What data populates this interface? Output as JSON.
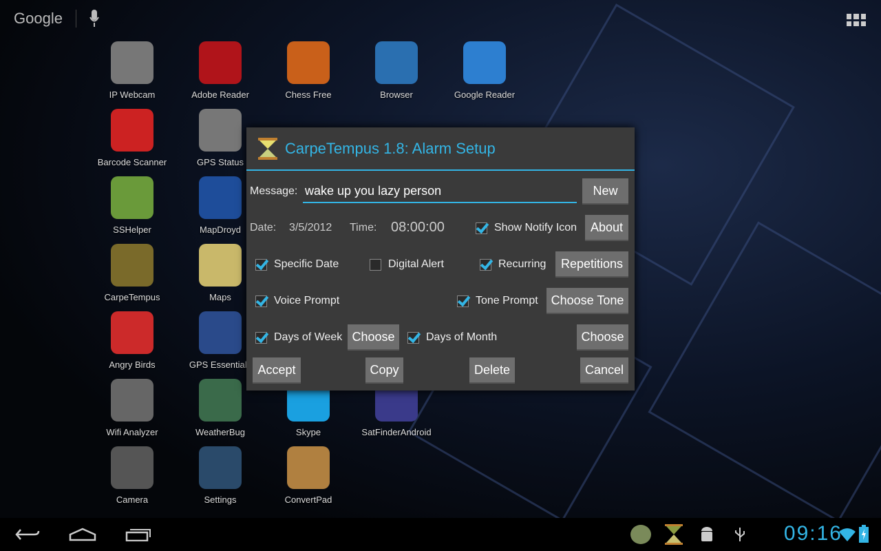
{
  "topbar": {
    "search_label": "Google"
  },
  "apps": [
    {
      "label": "IP Webcam",
      "color": "#777"
    },
    {
      "label": "Adobe Reader",
      "color": "#b0141a"
    },
    {
      "label": "Chess Free",
      "color": "#c9601a"
    },
    {
      "label": "Browser",
      "color": "#2a6fb0"
    },
    {
      "label": "Google Reader",
      "color": "#2d7fd0"
    },
    {
      "label": "Barcode Scanner",
      "color": "#cc2222"
    },
    {
      "label": "GPS Status",
      "color": "#777"
    },
    {
      "label": "SSHelper",
      "color": "#6a9a3a"
    },
    {
      "label": "MapDroyd",
      "color": "#1e4d9a"
    },
    {
      "label": "CarpeTempus",
      "color": "#7a6a2a"
    },
    {
      "label": "Maps",
      "color": "#c9b86a"
    },
    {
      "label": "Angry Birds",
      "color": "#cc2a2a"
    },
    {
      "label": "GPS Essentials",
      "color": "#2a4a8a"
    },
    {
      "label": "Wifi Analyzer",
      "color": "#666"
    },
    {
      "label": "WeatherBug",
      "color": "#3a6a4a"
    },
    {
      "label": "Skype",
      "color": "#1aa0e0"
    },
    {
      "label": "SatFinderAndroid",
      "color": "#3a3a8a"
    },
    {
      "label": "Camera",
      "color": "#555"
    },
    {
      "label": "Settings",
      "color": "#2a4a6a"
    },
    {
      "label": "ConvertPad",
      "color": "#b08040"
    }
  ],
  "dialog": {
    "title": "CarpeTempus 1.8: Alarm Setup",
    "message_label": "Message:",
    "message_value": "wake up you lazy person",
    "date_label": "Date:",
    "date_value": "3/5/2012",
    "time_label": "Time:",
    "time_value": "08:00:00",
    "show_notify": "Show Notify Icon",
    "specific_date": "Specific Date",
    "digital_alert": "Digital Alert",
    "recurring": "Recurring",
    "voice_prompt": "Voice Prompt",
    "tone_prompt": "Tone Prompt",
    "days_of_week": "Days of Week",
    "days_of_month": "Days of Month",
    "buttons": {
      "new": "New",
      "about": "About",
      "repetitions": "Repetitions",
      "choose_tone": "Choose Tone",
      "choose_week": "Choose",
      "choose_month": "Choose",
      "accept": "Accept",
      "copy": "Copy",
      "delete": "Delete",
      "cancel": "Cancel"
    }
  },
  "statusbar": {
    "time": "09:16"
  }
}
